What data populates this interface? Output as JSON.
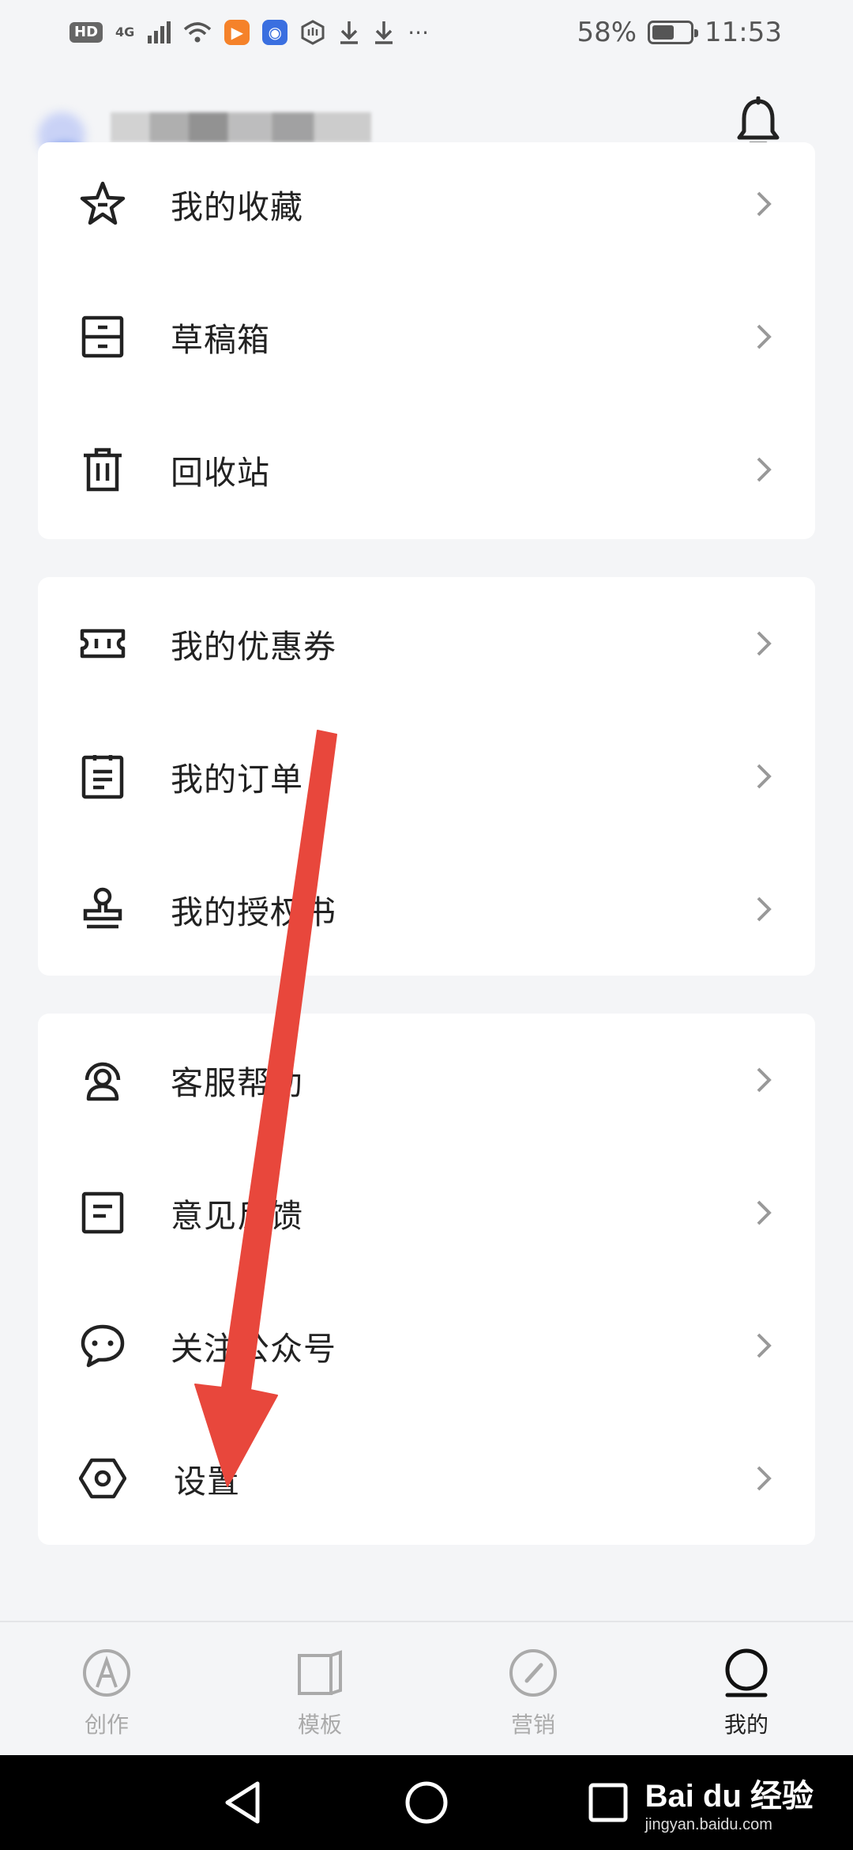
{
  "status_bar": {
    "hd_badge": "HD",
    "network": "4G",
    "more": "···",
    "battery_pct": "58%",
    "time": "11:53"
  },
  "header": {
    "bell_icon": "bell-icon"
  },
  "groups": [
    {
      "items": [
        {
          "label": "我的收藏",
          "icon": "star-icon"
        },
        {
          "label": "草稿箱",
          "icon": "drawer-icon"
        },
        {
          "label": "回收站",
          "icon": "trash-icon"
        }
      ]
    },
    {
      "items": [
        {
          "label": "我的优惠券",
          "icon": "coupon-icon"
        },
        {
          "label": "我的订单",
          "icon": "order-icon"
        },
        {
          "label": "我的授权书",
          "icon": "stamp-icon"
        }
      ]
    },
    {
      "items": [
        {
          "label": "客服帮助",
          "icon": "support-icon"
        },
        {
          "label": "意见反馈",
          "icon": "feedback-icon"
        },
        {
          "label": "关注公众号",
          "icon": "chat-icon"
        },
        {
          "label": "设置",
          "icon": "settings-icon"
        }
      ]
    }
  ],
  "tabs": [
    {
      "label": "创作",
      "icon": "pen-icon",
      "active": false
    },
    {
      "label": "模板",
      "icon": "template-icon",
      "active": false
    },
    {
      "label": "营销",
      "icon": "compass-icon",
      "active": false
    },
    {
      "label": "我的",
      "icon": "profile-icon",
      "active": true
    }
  ],
  "watermark": {
    "brand": "Bai du 经验",
    "url": "jingyan.baidu.com"
  },
  "colors": {
    "accent_arrow": "#e8473c",
    "page_bg": "#f4f5f7",
    "card_bg": "#ffffff",
    "active_tab": "#222222",
    "inactive_tab": "#aaaaaa"
  }
}
